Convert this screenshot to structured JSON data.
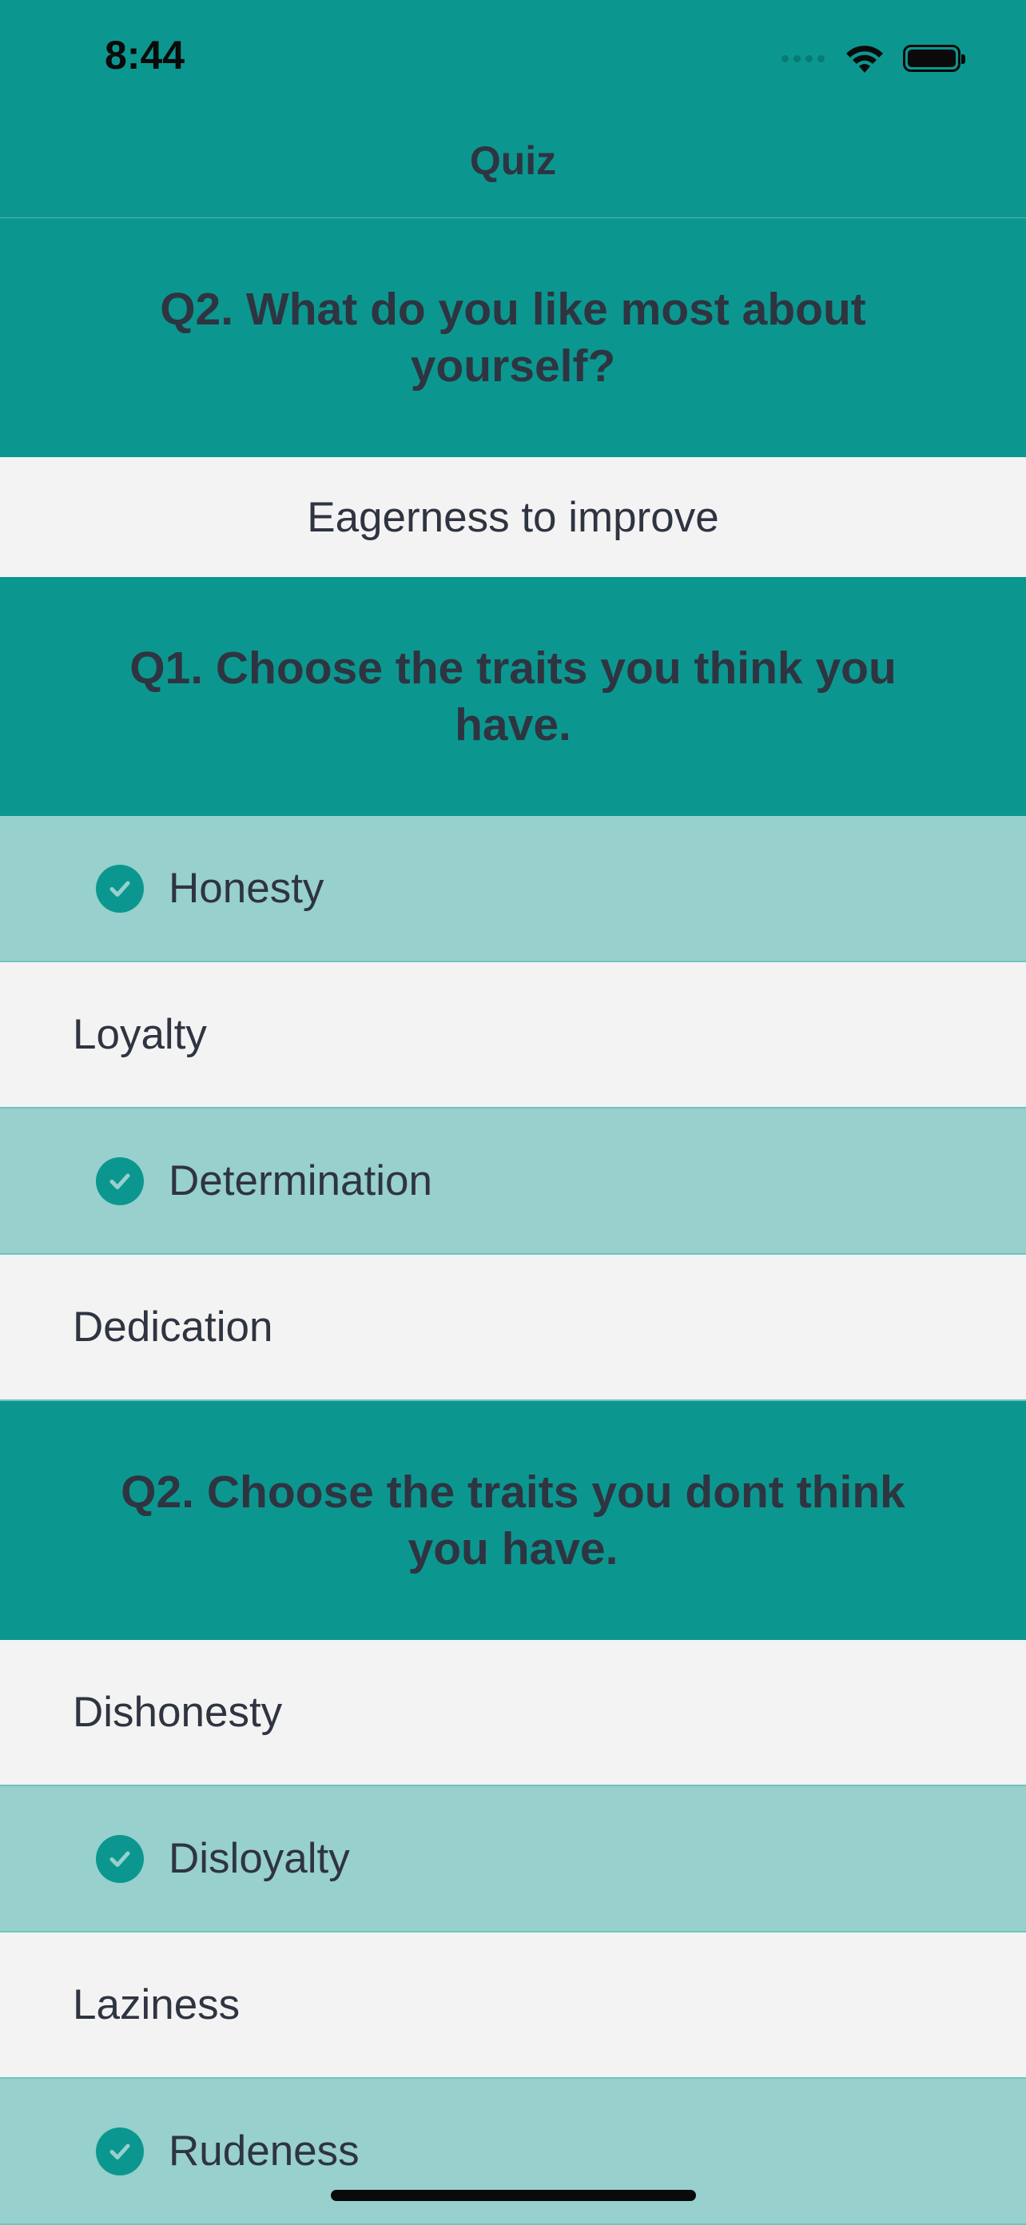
{
  "status_bar": {
    "time": "8:44",
    "icons": [
      "cellular-signal-icon",
      "wifi-icon",
      "battery-icon"
    ]
  },
  "nav": {
    "title": "Quiz"
  },
  "sections": {
    "q2_likes": {
      "question": "Q2. What do you like most about yourself?",
      "answer": "Eagerness to improve"
    },
    "q1_traits": {
      "question": "Q1. Choose the traits you think you have.",
      "options": [
        {
          "label": "Honesty",
          "selected": true
        },
        {
          "label": "Loyalty",
          "selected": false
        },
        {
          "label": "Determination",
          "selected": true
        },
        {
          "label": "Dedication",
          "selected": false
        }
      ]
    },
    "q2_traits": {
      "question": "Q2. Choose the traits you dont think you have.",
      "options": [
        {
          "label": "Dishonesty",
          "selected": false
        },
        {
          "label": "Disloyalty",
          "selected": true
        },
        {
          "label": "Laziness",
          "selected": false
        },
        {
          "label": "Rudeness",
          "selected": true
        }
      ]
    }
  },
  "colors": {
    "header_teal": "#0b978f",
    "selected_row": "#97d0cd",
    "row_background": "#f3f3f3",
    "text": "#2f3441"
  }
}
